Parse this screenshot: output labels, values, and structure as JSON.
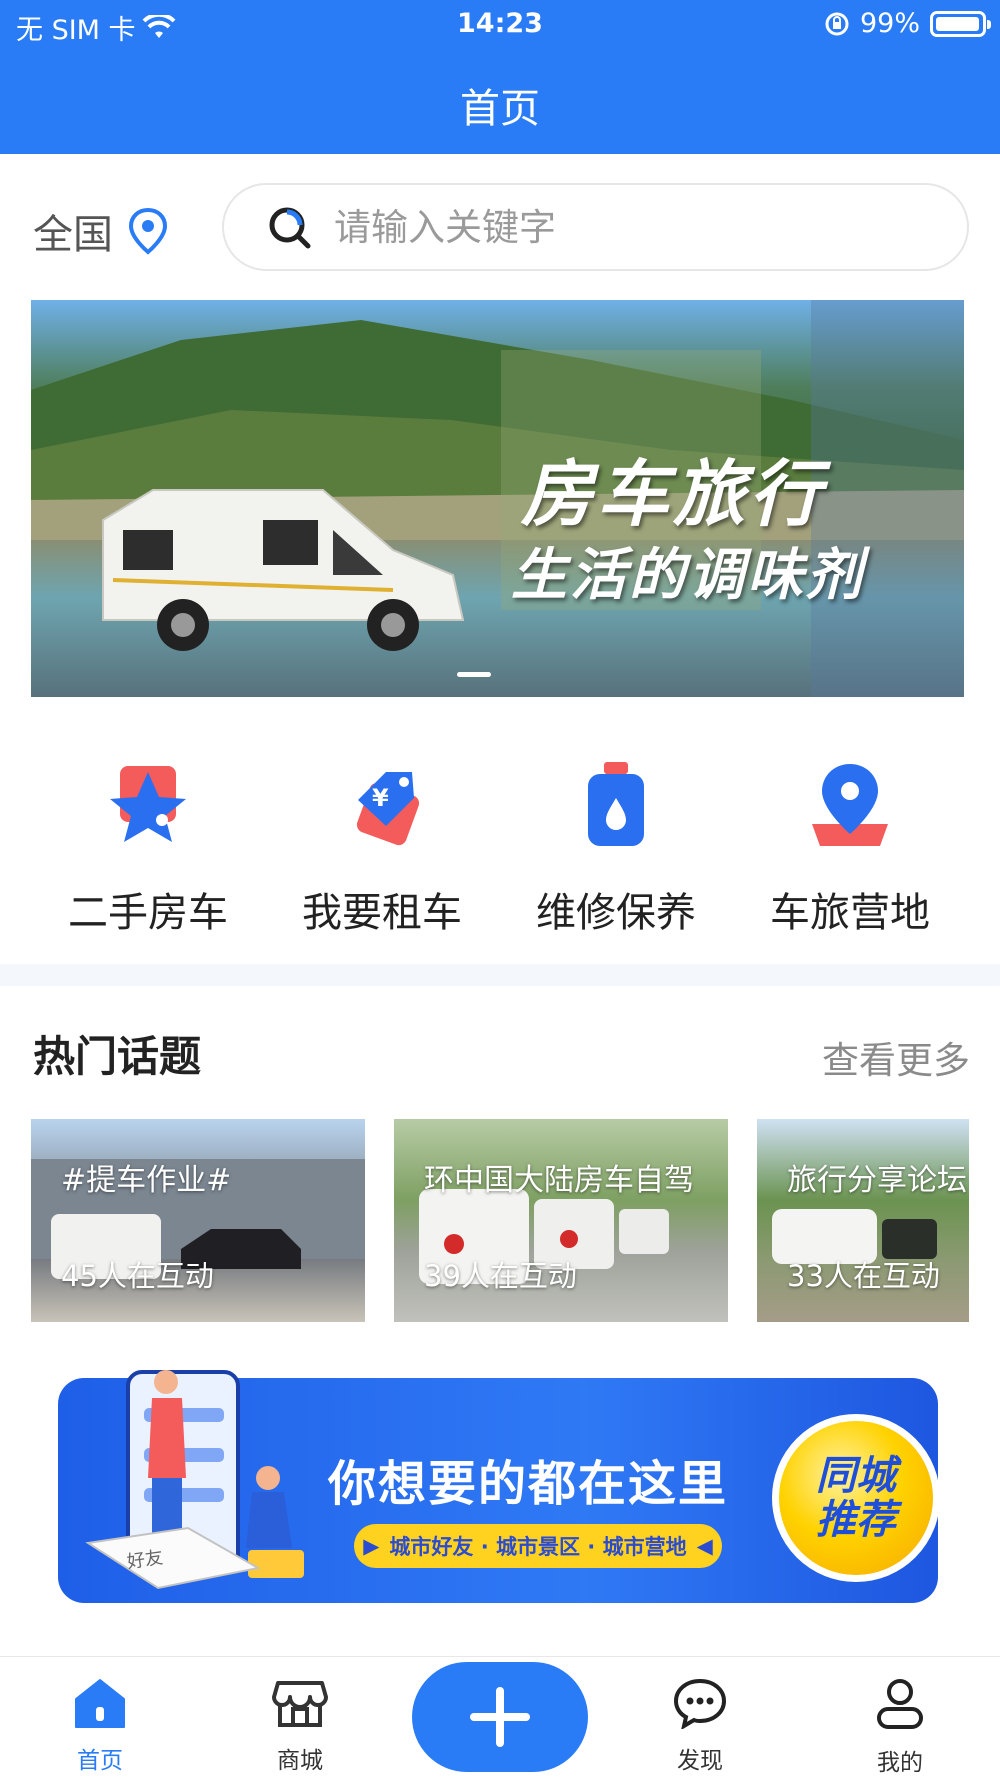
{
  "status_bar": {
    "carrier": "无 SIM 卡",
    "time": "14:23",
    "battery": "99%"
  },
  "nav": {
    "title": "首页"
  },
  "search": {
    "region": "全国",
    "placeholder": "请输入关键字"
  },
  "banner": {
    "title_line1": "房车旅行",
    "title_line2": "生活的调味剂"
  },
  "quick_entries": [
    {
      "label": "二手房车",
      "icon": "star-icon"
    },
    {
      "label": "我要租车",
      "icon": "tag-icon"
    },
    {
      "label": "维修保养",
      "icon": "oil-bottle-icon"
    },
    {
      "label": "车旅营地",
      "icon": "location-pin-icon"
    }
  ],
  "hot_topics": {
    "title": "热门话题",
    "more": "查看更多",
    "items": [
      {
        "name": "#提车作业#",
        "count": "45人在互动"
      },
      {
        "name": "环中国大陆房车自驾",
        "count": "39人在互动"
      },
      {
        "name": "旅行分享论坛",
        "count": "33人在互动"
      }
    ]
  },
  "promo": {
    "headline": "你想要的都在这里",
    "tags": "城市好友 · 城市景区 · 城市营地",
    "badge_line1": "同城",
    "badge_line2": "推荐",
    "book_text": "好友"
  },
  "tabbar": {
    "items": [
      {
        "label": "首页",
        "icon": "home-icon",
        "active": true
      },
      {
        "label": "商城",
        "icon": "shop-icon"
      },
      {
        "label": "发现",
        "icon": "chat-bubble-icon"
      },
      {
        "label": "我的",
        "icon": "user-icon"
      }
    ],
    "center_icon": "plus-icon"
  },
  "colors": {
    "primary": "#2a7cf6",
    "accent_red": "#f45b5b",
    "promo_yellow": "#ffd21f"
  }
}
